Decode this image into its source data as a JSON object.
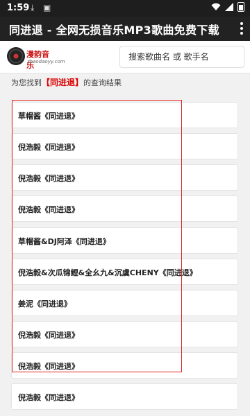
{
  "status_bar": {
    "time": "1:59",
    "download_icon": "download-icon",
    "notify_icon": "notification-icon",
    "wifi_icon": "wifi-icon",
    "signal_icon": "signal-icon",
    "battery_icon": "battery-icon"
  },
  "app_bar": {
    "title": "同进退 - 全网无损音乐MP3歌曲免费下载",
    "menu_icon": "more-vertical-icon"
  },
  "header": {
    "logo_text": "漫韵音乐",
    "logo_sub": "zhaodaoyy.com",
    "search_placeholder": "搜索歌曲名 或 歌手名"
  },
  "result_info": {
    "prefix": "为您找到",
    "bracket_open": "【",
    "keyword": "同进退",
    "bracket_close": "】",
    "suffix": "的查询结果"
  },
  "results": [
    {
      "text": "草帽酱《同进退》"
    },
    {
      "text": "倪浩毅《同进退》"
    },
    {
      "text": "倪浩毅《同进退》"
    },
    {
      "text": "倪浩毅《同进退》"
    },
    {
      "text": "草帽酱&DJ阿泽《同进退》"
    },
    {
      "text": "倪浩毅&次瓜锦鲤&全幺九&沉虞CHENY《同进退》"
    },
    {
      "text": "姜泥《同进退》"
    },
    {
      "text": "倪浩毅《同进退》"
    },
    {
      "text": "倪浩毅《同进退》"
    },
    {
      "text": "倪浩毅《同进退》"
    }
  ],
  "colors": {
    "highlight": "#e02020",
    "keyword": "#dd0000",
    "app_bar": "#222222"
  }
}
